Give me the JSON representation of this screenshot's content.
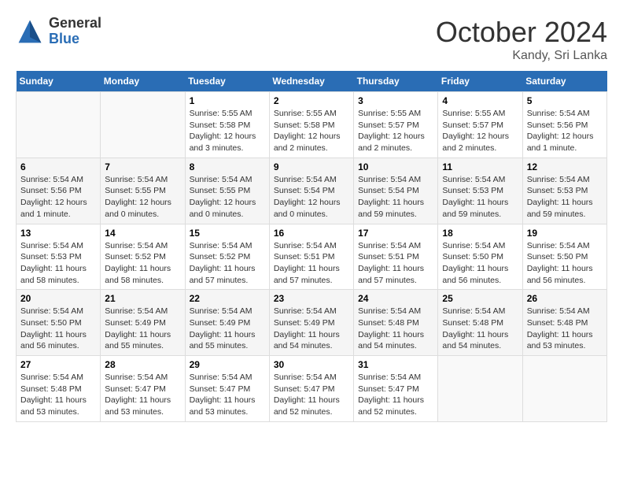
{
  "logo": {
    "general": "General",
    "blue": "Blue"
  },
  "title": "October 2024",
  "location": "Kandy, Sri Lanka",
  "headers": [
    "Sunday",
    "Monday",
    "Tuesday",
    "Wednesday",
    "Thursday",
    "Friday",
    "Saturday"
  ],
  "weeks": [
    [
      {
        "day": "",
        "info": ""
      },
      {
        "day": "",
        "info": ""
      },
      {
        "day": "1",
        "info": "Sunrise: 5:55 AM\nSunset: 5:58 PM\nDaylight: 12 hours\nand 3 minutes."
      },
      {
        "day": "2",
        "info": "Sunrise: 5:55 AM\nSunset: 5:58 PM\nDaylight: 12 hours\nand 2 minutes."
      },
      {
        "day": "3",
        "info": "Sunrise: 5:55 AM\nSunset: 5:57 PM\nDaylight: 12 hours\nand 2 minutes."
      },
      {
        "day": "4",
        "info": "Sunrise: 5:55 AM\nSunset: 5:57 PM\nDaylight: 12 hours\nand 2 minutes."
      },
      {
        "day": "5",
        "info": "Sunrise: 5:54 AM\nSunset: 5:56 PM\nDaylight: 12 hours\nand 1 minute."
      }
    ],
    [
      {
        "day": "6",
        "info": "Sunrise: 5:54 AM\nSunset: 5:56 PM\nDaylight: 12 hours\nand 1 minute."
      },
      {
        "day": "7",
        "info": "Sunrise: 5:54 AM\nSunset: 5:55 PM\nDaylight: 12 hours\nand 0 minutes."
      },
      {
        "day": "8",
        "info": "Sunrise: 5:54 AM\nSunset: 5:55 PM\nDaylight: 12 hours\nand 0 minutes."
      },
      {
        "day": "9",
        "info": "Sunrise: 5:54 AM\nSunset: 5:54 PM\nDaylight: 12 hours\nand 0 minutes."
      },
      {
        "day": "10",
        "info": "Sunrise: 5:54 AM\nSunset: 5:54 PM\nDaylight: 11 hours\nand 59 minutes."
      },
      {
        "day": "11",
        "info": "Sunrise: 5:54 AM\nSunset: 5:53 PM\nDaylight: 11 hours\nand 59 minutes."
      },
      {
        "day": "12",
        "info": "Sunrise: 5:54 AM\nSunset: 5:53 PM\nDaylight: 11 hours\nand 59 minutes."
      }
    ],
    [
      {
        "day": "13",
        "info": "Sunrise: 5:54 AM\nSunset: 5:53 PM\nDaylight: 11 hours\nand 58 minutes."
      },
      {
        "day": "14",
        "info": "Sunrise: 5:54 AM\nSunset: 5:52 PM\nDaylight: 11 hours\nand 58 minutes."
      },
      {
        "day": "15",
        "info": "Sunrise: 5:54 AM\nSunset: 5:52 PM\nDaylight: 11 hours\nand 57 minutes."
      },
      {
        "day": "16",
        "info": "Sunrise: 5:54 AM\nSunset: 5:51 PM\nDaylight: 11 hours\nand 57 minutes."
      },
      {
        "day": "17",
        "info": "Sunrise: 5:54 AM\nSunset: 5:51 PM\nDaylight: 11 hours\nand 57 minutes."
      },
      {
        "day": "18",
        "info": "Sunrise: 5:54 AM\nSunset: 5:50 PM\nDaylight: 11 hours\nand 56 minutes."
      },
      {
        "day": "19",
        "info": "Sunrise: 5:54 AM\nSunset: 5:50 PM\nDaylight: 11 hours\nand 56 minutes."
      }
    ],
    [
      {
        "day": "20",
        "info": "Sunrise: 5:54 AM\nSunset: 5:50 PM\nDaylight: 11 hours\nand 56 minutes."
      },
      {
        "day": "21",
        "info": "Sunrise: 5:54 AM\nSunset: 5:49 PM\nDaylight: 11 hours\nand 55 minutes."
      },
      {
        "day": "22",
        "info": "Sunrise: 5:54 AM\nSunset: 5:49 PM\nDaylight: 11 hours\nand 55 minutes."
      },
      {
        "day": "23",
        "info": "Sunrise: 5:54 AM\nSunset: 5:49 PM\nDaylight: 11 hours\nand 54 minutes."
      },
      {
        "day": "24",
        "info": "Sunrise: 5:54 AM\nSunset: 5:48 PM\nDaylight: 11 hours\nand 54 minutes."
      },
      {
        "day": "25",
        "info": "Sunrise: 5:54 AM\nSunset: 5:48 PM\nDaylight: 11 hours\nand 54 minutes."
      },
      {
        "day": "26",
        "info": "Sunrise: 5:54 AM\nSunset: 5:48 PM\nDaylight: 11 hours\nand 53 minutes."
      }
    ],
    [
      {
        "day": "27",
        "info": "Sunrise: 5:54 AM\nSunset: 5:48 PM\nDaylight: 11 hours\nand 53 minutes."
      },
      {
        "day": "28",
        "info": "Sunrise: 5:54 AM\nSunset: 5:47 PM\nDaylight: 11 hours\nand 53 minutes."
      },
      {
        "day": "29",
        "info": "Sunrise: 5:54 AM\nSunset: 5:47 PM\nDaylight: 11 hours\nand 53 minutes."
      },
      {
        "day": "30",
        "info": "Sunrise: 5:54 AM\nSunset: 5:47 PM\nDaylight: 11 hours\nand 52 minutes."
      },
      {
        "day": "31",
        "info": "Sunrise: 5:54 AM\nSunset: 5:47 PM\nDaylight: 11 hours\nand 52 minutes."
      },
      {
        "day": "",
        "info": ""
      },
      {
        "day": "",
        "info": ""
      }
    ]
  ]
}
